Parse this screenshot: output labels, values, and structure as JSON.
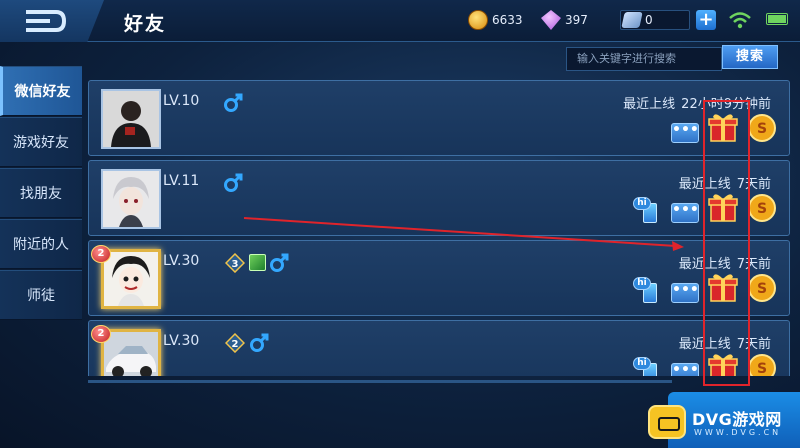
{
  "header": {
    "title": "好友",
    "gold": "6633",
    "gems": "397",
    "vouchers": "0",
    "plus_label": "+"
  },
  "search": {
    "placeholder": "输入关键字进行搜索",
    "button_label": "搜索"
  },
  "sidebar": {
    "tabs": [
      {
        "label": "微信好友",
        "active": true
      },
      {
        "label": "游戏好友",
        "active": false
      },
      {
        "label": "找朋友",
        "active": false
      },
      {
        "label": "附近的人",
        "active": false
      },
      {
        "label": "师徒",
        "active": false
      }
    ]
  },
  "friends": [
    {
      "level": "LV.10",
      "gender": "male",
      "last_online_label": "最近上线",
      "last_online_value": "22小时9分钟前",
      "has_hi": false,
      "avatar_badge": ""
    },
    {
      "level": "LV.11",
      "gender": "male",
      "last_online_label": "最近上线",
      "last_online_value": "7天前",
      "has_hi": true,
      "avatar_badge": ""
    },
    {
      "level": "LV.30",
      "gender": "male",
      "last_online_label": "最近上线",
      "last_online_value": "7天前",
      "has_hi": true,
      "avatar_badge": "2",
      "rank_badge": "3"
    },
    {
      "level": "LV.30",
      "gender": "male",
      "last_online_label": "最近上线",
      "last_online_value": "7天前",
      "has_hi": true,
      "avatar_badge": "2",
      "rank_badge": "2"
    }
  ],
  "buttons": {
    "message_label": "•••",
    "hi_label": "hi"
  },
  "watermark": {
    "text": "DVG游戏网",
    "sub": "WWW.DVG.CN"
  },
  "colors": {
    "accent": "#2f6fb3",
    "highlight": "#e0242b",
    "male": "#33a8ff"
  }
}
